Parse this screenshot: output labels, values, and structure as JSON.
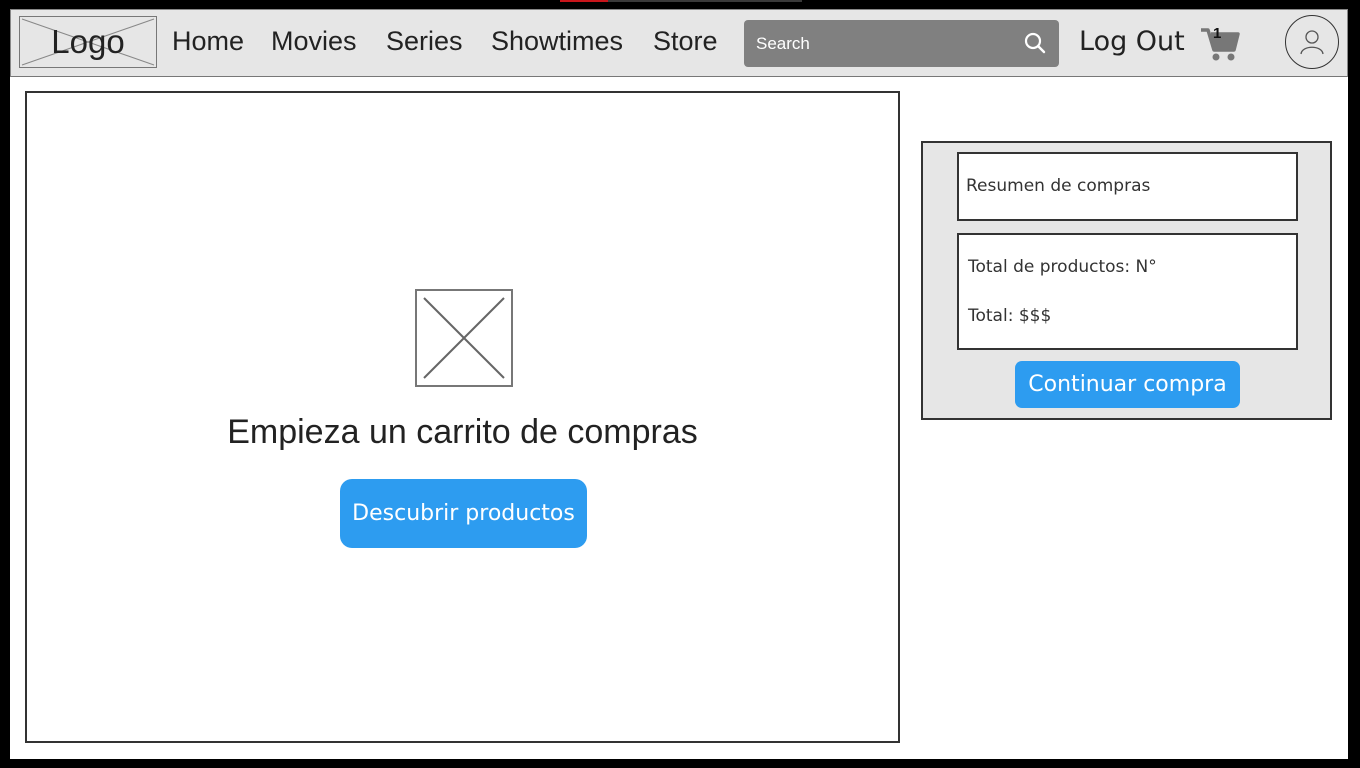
{
  "header": {
    "logo_text": "Logo",
    "nav": [
      "Home",
      "Movies",
      "Series",
      "Showtimes",
      "Store"
    ],
    "search_placeholder": "Search",
    "logout_label": "Log Out",
    "cart_count": "1"
  },
  "icons": {
    "logo": "image-placeholder-icon",
    "search": "search-icon",
    "cart": "shopping-cart-icon",
    "avatar": "user-icon",
    "empty_cart_image": "image-placeholder-icon"
  },
  "colors": {
    "accent": "#2d9cf0",
    "navbar_bg": "#e6e6e6",
    "search_bg": "#808080"
  },
  "cart": {
    "empty_title": "Empieza un carrito de compras",
    "discover_label": "Descubrir productos"
  },
  "summary": {
    "title": "Resumen de compras",
    "total_products": "Total de productos: N°",
    "total_amount": "Total: $$$",
    "continue_label": "Continuar compra"
  }
}
